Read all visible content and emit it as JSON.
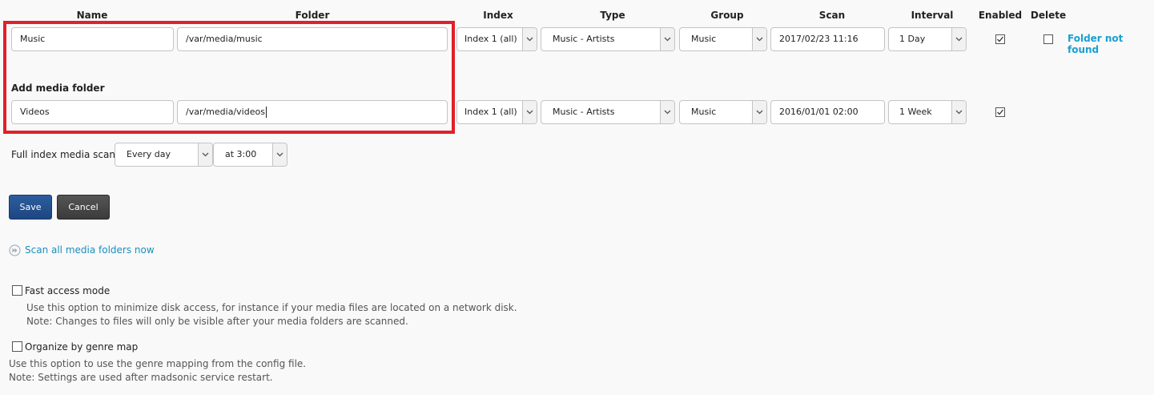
{
  "headers": {
    "name": "Name",
    "folder": "Folder",
    "index": "Index",
    "type": "Type",
    "group": "Group",
    "scan": "Scan",
    "interval": "Interval",
    "enabled": "Enabled",
    "delete": "Delete"
  },
  "folders": [
    {
      "name": "Music",
      "path": "/var/media/music",
      "index": "Index 1 (all)",
      "type": "Music - Artists",
      "group": "Music",
      "scan": "2017/02/23 11:16",
      "interval": "1 Day",
      "enabled": true,
      "delete": false,
      "status": "Folder not found"
    }
  ],
  "add_folder": {
    "label": "Add media folder",
    "name": "Videos",
    "path": "/var/media/videos",
    "index": "Index 1 (all)",
    "type": "Music - Artists",
    "group": "Music",
    "scan": "2016/01/01 02:00",
    "interval": "1 Week",
    "enabled": true
  },
  "full_scan": {
    "label": "Full index media scan",
    "frequency": "Every day",
    "time": "at 3:00"
  },
  "buttons": {
    "save": "Save",
    "cancel": "Cancel"
  },
  "scan_all": {
    "label": "Scan all media folders now",
    "icon": "fast-forward-circle-icon"
  },
  "fast_access": {
    "label": "Fast access mode",
    "checked": false,
    "desc1": "Use this option to minimize disk access, for instance if your media files are located on a network disk.",
    "desc2": "Note: Changes to files will only be visible after your media folders are scanned."
  },
  "genre_map": {
    "label": "Organize by genre map",
    "checked": false,
    "desc1": "Use this option to use the genre mapping from the config file.",
    "desc2": "Note: Settings are used after madsonic service restart."
  },
  "colors": {
    "highlight": "#e0202a",
    "link": "#1a8fbf",
    "save_button": "#1d4680",
    "cancel_button": "#3b3b3b"
  }
}
